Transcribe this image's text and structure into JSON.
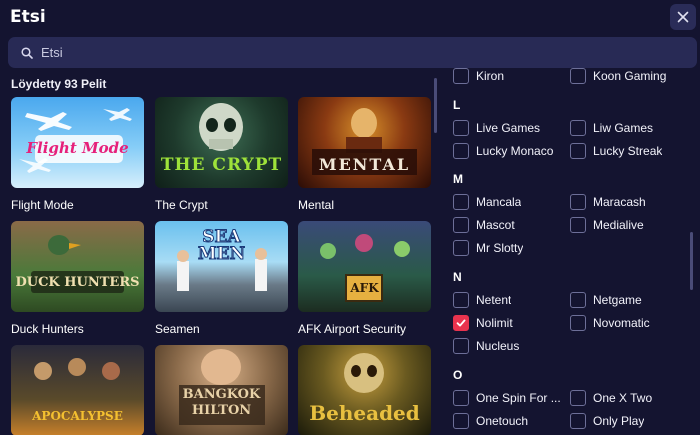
{
  "header": {
    "title": "Etsi"
  },
  "search": {
    "placeholder": "Etsi",
    "value": ""
  },
  "results": {
    "label": "Löydetty 93 Pelit"
  },
  "games": [
    {
      "name": "Flight Mode",
      "art_text": "Flight Mode"
    },
    {
      "name": "The Crypt",
      "art_text": "THE CRYPT"
    },
    {
      "name": "Mental",
      "art_text": "MENTAL"
    },
    {
      "name": "Duck Hunters",
      "art_text": "DUCK HUNTERS"
    },
    {
      "name": "Seamen",
      "art_text": "SEA MEN"
    },
    {
      "name": "AFK Airport Security",
      "art_text": "AFK"
    },
    {
      "name": "",
      "art_text": "APOCALYPSE"
    },
    {
      "name": "",
      "art_text": "BANGKOK HILTON"
    },
    {
      "name": "",
      "art_text": "Beheaded"
    }
  ],
  "filters": {
    "top_partial": [
      "Kiron",
      "Koon Gaming"
    ],
    "groups": [
      {
        "letter": "L",
        "options": [
          {
            "label": "Live Games",
            "checked": false
          },
          {
            "label": "Liw Games",
            "checked": false
          },
          {
            "label": "Lucky Monaco",
            "checked": false
          },
          {
            "label": "Lucky Streak",
            "checked": false
          }
        ]
      },
      {
        "letter": "M",
        "options": [
          {
            "label": "Mancala",
            "checked": false
          },
          {
            "label": "Maracash",
            "checked": false
          },
          {
            "label": "Mascot",
            "checked": false
          },
          {
            "label": "Medialive",
            "checked": false
          },
          {
            "label": "Mr Slotty",
            "checked": false
          }
        ]
      },
      {
        "letter": "N",
        "options": [
          {
            "label": "Netent",
            "checked": false
          },
          {
            "label": "Netgame",
            "checked": false
          },
          {
            "label": "Nolimit",
            "checked": true
          },
          {
            "label": "Novomatic",
            "checked": false
          },
          {
            "label": "Nucleus",
            "checked": false
          }
        ]
      },
      {
        "letter": "O",
        "options": [
          {
            "label": "One Spin For ...",
            "checked": false
          },
          {
            "label": "One X Two",
            "checked": false
          },
          {
            "label": "Onetouch",
            "checked": false
          },
          {
            "label": "Only Play",
            "checked": false
          }
        ]
      }
    ]
  },
  "colors": {
    "background": "#141430",
    "accent": "#e8334e",
    "search_bg": "#282a55"
  },
  "icons": {
    "close": "close-icon",
    "search": "search-icon",
    "check": "check-icon"
  }
}
